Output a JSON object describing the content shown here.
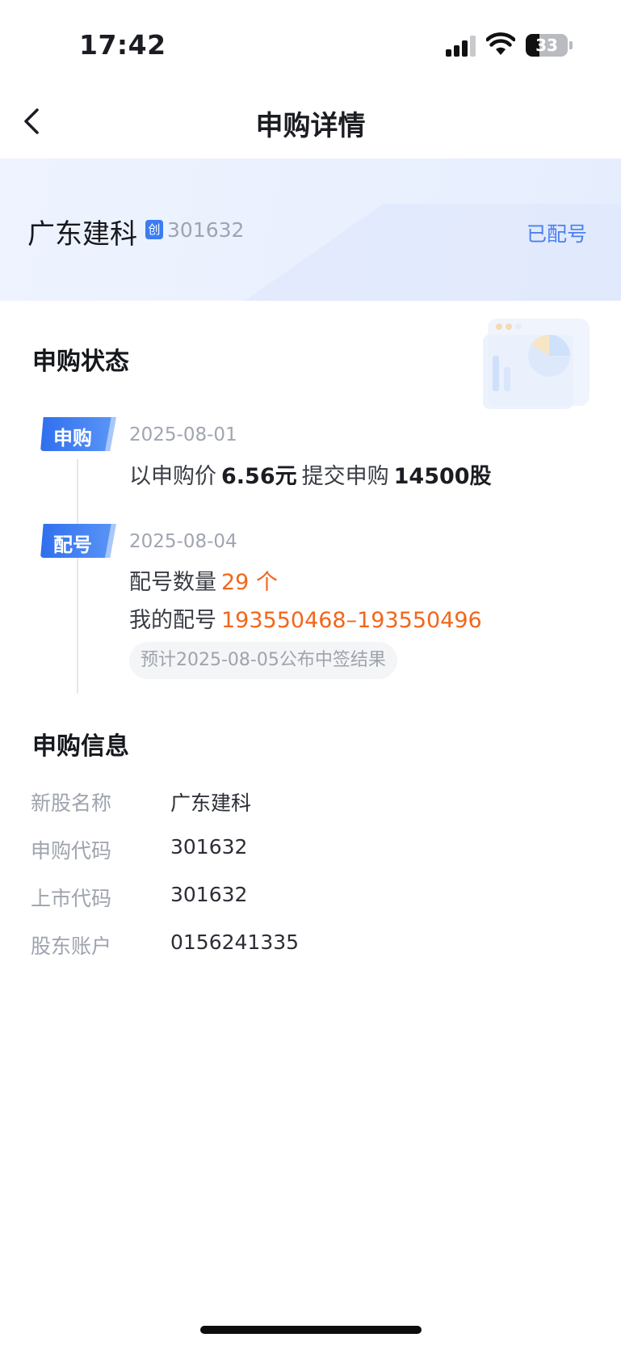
{
  "status_bar": {
    "time": "17:42",
    "battery": "33",
    "battery_level": 0.33
  },
  "nav": {
    "title": "申购详情",
    "back_icon": "chevron-left-icon"
  },
  "stock": {
    "name": "广东建科",
    "board_tag": "创",
    "code": "301632",
    "status": "已配号"
  },
  "subscription_status": {
    "title": "申购状态",
    "events": [
      {
        "badge": "申购",
        "date": "2025-08-01",
        "prefix": "以申购价",
        "price": "6.56元",
        "middle": "提交申购",
        "quantity": "14500股"
      },
      {
        "badge": "配号",
        "date": "2025-08-04",
        "count_label": "配号数量",
        "count_value": "29 个",
        "range_label": "我的配号",
        "range_value": "193550468–193550496",
        "note": "预计2025-08-05公布中签结果"
      }
    ]
  },
  "subscription_info": {
    "title": "申购信息",
    "rows": [
      {
        "label": "新股名称",
        "value": "广东建科"
      },
      {
        "label": "申购代码",
        "value": "301632"
      },
      {
        "label": "上市代码",
        "value": "301632"
      },
      {
        "label": "股东账户",
        "value": "0156241335"
      }
    ]
  },
  "colors": {
    "accent": "#3b7cf3",
    "highlight": "#f2661c",
    "header_bg": "#eef3ff"
  }
}
